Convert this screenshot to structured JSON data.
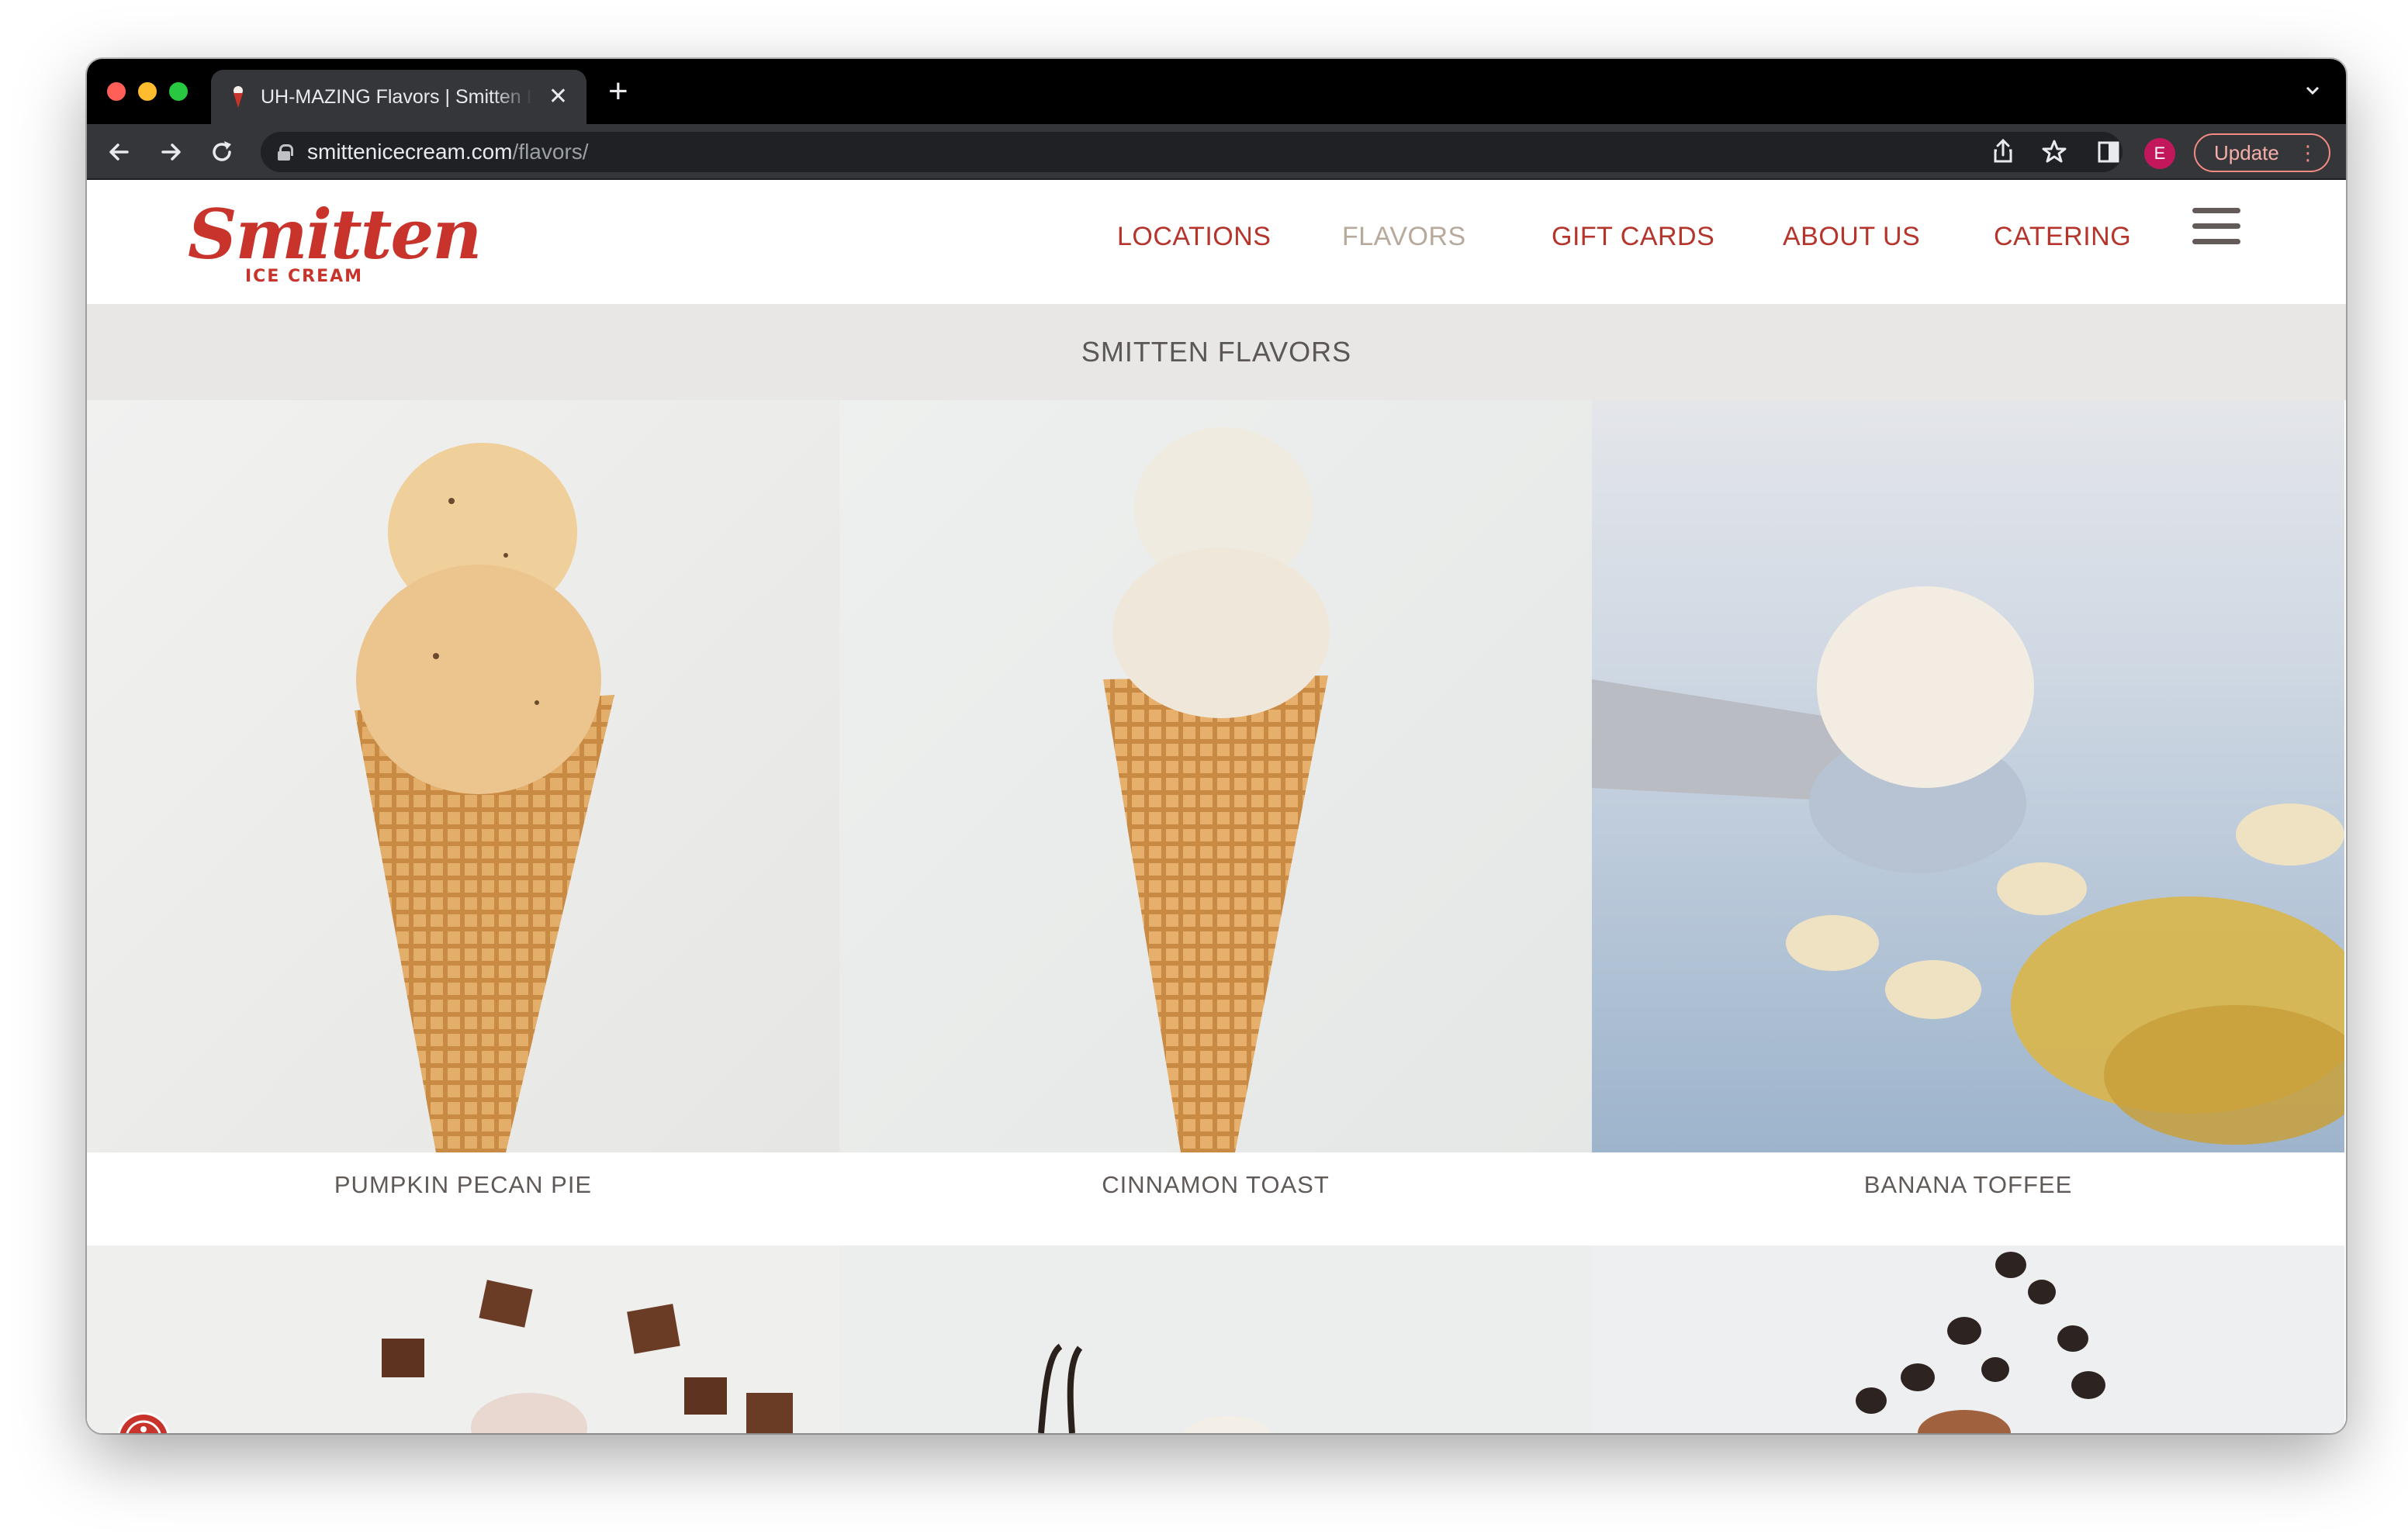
{
  "browser": {
    "tab_title": "UH-MAZING Flavors | Smitten Ice Cream",
    "tab_close": "✕",
    "new_tab": "+",
    "url_host": "smittenicecream.com",
    "url_path": "/flavors/",
    "avatar_initial": "E",
    "update_label": "Update"
  },
  "site": {
    "logo_script": "Smitten",
    "logo_sub": "ICE CREAM",
    "brand_color": "#c8342b",
    "nav": [
      {
        "label": "LOCATIONS",
        "active": false
      },
      {
        "label": "FLAVORS",
        "active": true
      },
      {
        "label": "GIFT CARDS",
        "active": false
      },
      {
        "label": "ABOUT US",
        "active": false
      },
      {
        "label": "CATERING",
        "active": false
      }
    ],
    "page_title": "SMITTEN FLAVORS"
  },
  "flavors": [
    {
      "name": "PUMPKIN PECAN PIE"
    },
    {
      "name": "CINNAMON TOAST"
    },
    {
      "name": "BANANA TOFFEE"
    }
  ],
  "icons": {
    "back": "back-arrow-icon",
    "forward": "forward-arrow-icon",
    "reload": "reload-icon",
    "lock": "lock-icon",
    "share": "share-icon",
    "bookmark": "star-icon",
    "sidepanel": "side-panel-icon",
    "menu": "hamburger-menu-icon",
    "accessibility": "accessibility-icon"
  }
}
